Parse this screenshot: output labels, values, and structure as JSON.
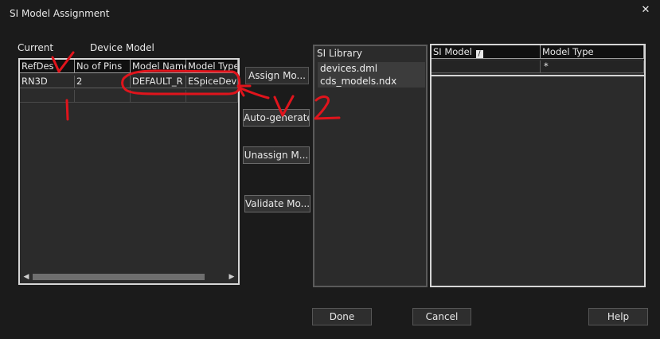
{
  "window": {
    "title": "SI Model Assignment",
    "close_glyph": "✕"
  },
  "left": {
    "label_current": "Current",
    "label_device_model": "Device Model",
    "columns": [
      "RefDes",
      "No of Pins",
      "Model Name",
      "Model Type"
    ],
    "rows": [
      {
        "refdes": "RN3D",
        "pins": "2",
        "model_name": "DEFAULT_R",
        "model_type": "ESpiceDevic"
      }
    ]
  },
  "buttons": {
    "assign": "Assign Mo...",
    "autogen": "Auto-generate",
    "unassign": "Unassign M...",
    "validate": "Validate Mo..."
  },
  "library": {
    "label": "SI Library",
    "items": [
      "devices.dml",
      "cds_models.ndx"
    ]
  },
  "si_model": {
    "columns": [
      "SI Model",
      "Model Type"
    ],
    "filter_row": [
      "",
      "*"
    ]
  },
  "footer": {
    "done": "Done",
    "cancel": "Cancel",
    "help": "Help"
  },
  "annotation": {
    "color": "#e0141c"
  }
}
